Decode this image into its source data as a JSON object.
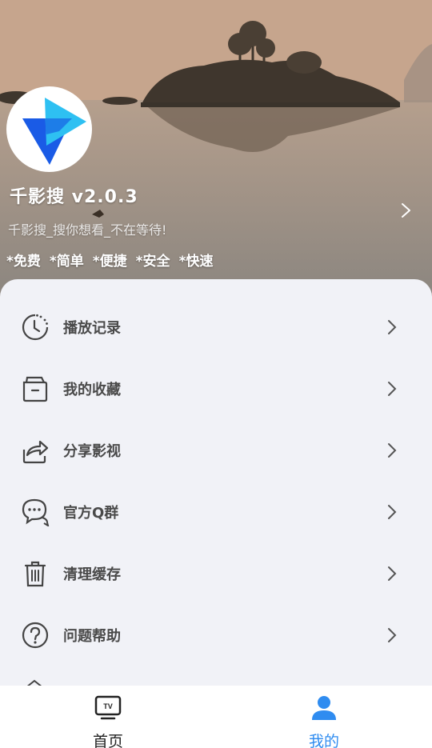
{
  "header": {
    "app_title": "千影搜 v2.0.3",
    "subtitle": "千影搜_搜你想看_不在等待!",
    "tags": [
      "*免费",
      "*简单",
      "*便捷",
      "*安全",
      "*快速"
    ]
  },
  "menu": [
    {
      "label": "播放记录",
      "icon": "clock-history-icon"
    },
    {
      "label": "我的收藏",
      "icon": "folder-icon"
    },
    {
      "label": "分享影视",
      "icon": "share-icon"
    },
    {
      "label": "官方Q群",
      "icon": "chat-bubble-icon"
    },
    {
      "label": "清理缓存",
      "icon": "trash-icon"
    },
    {
      "label": "问题帮助",
      "icon": "question-icon"
    }
  ],
  "tabbar": {
    "home_label": "首页",
    "mine_label": "我的",
    "active_color": "#2f8cf0",
    "inactive_color": "#222222"
  },
  "colors": {
    "accent": "#2f8cf0",
    "panel_bg": "#f1f2f7",
    "text": "#4a4a4a"
  }
}
